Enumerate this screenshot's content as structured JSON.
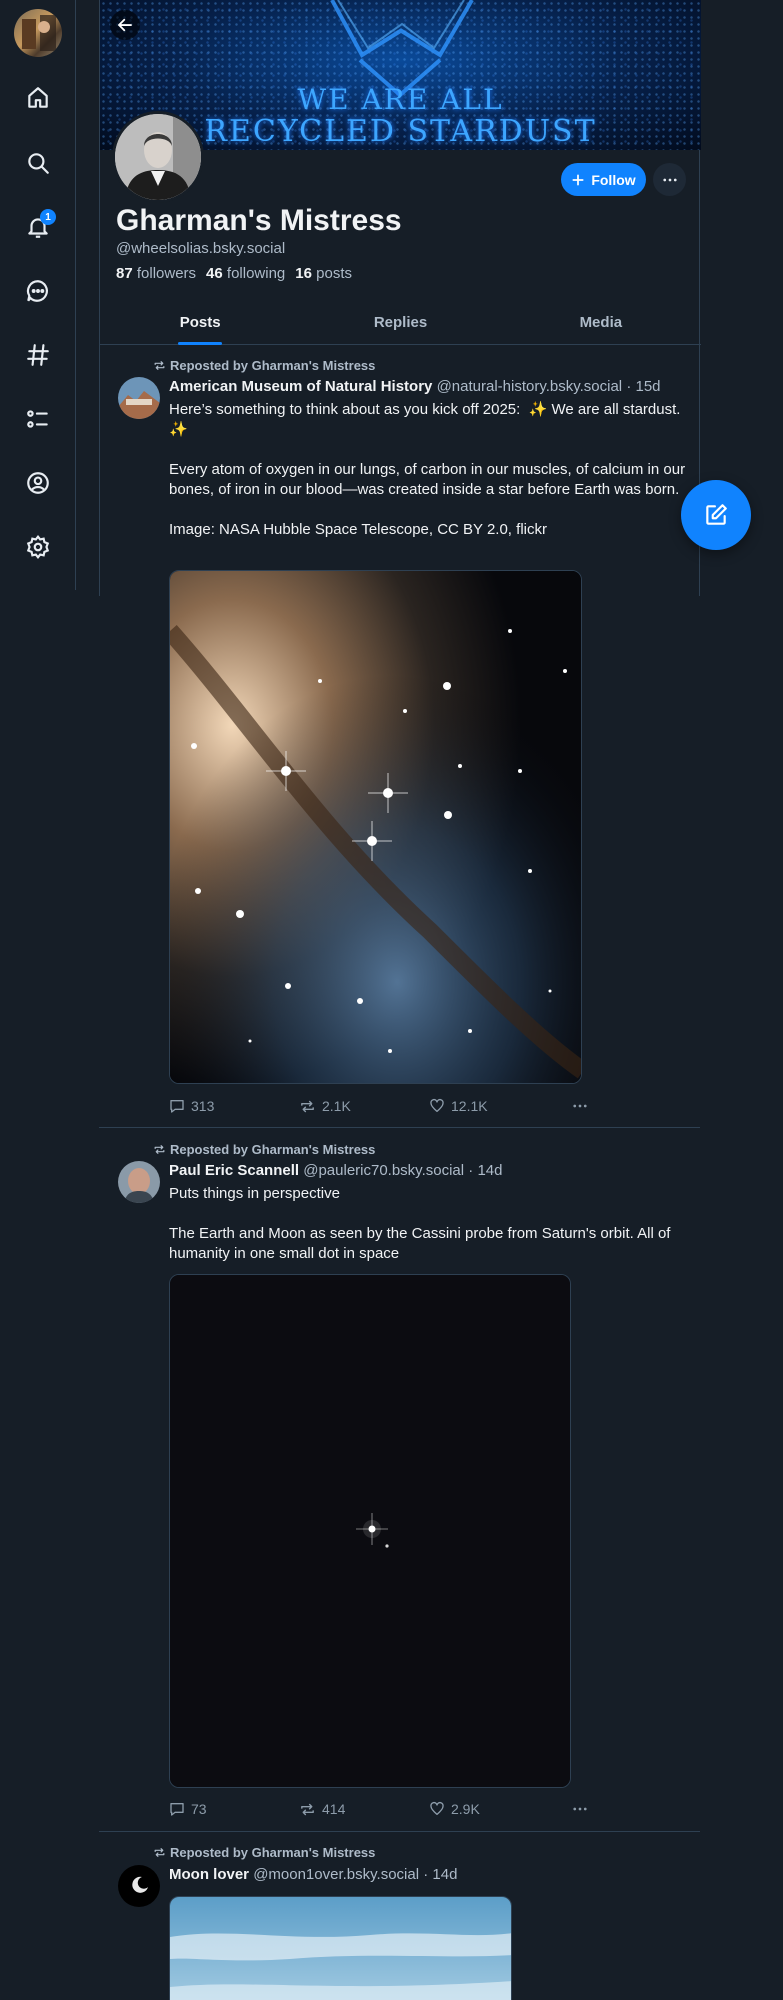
{
  "nav": {
    "notification_count": "1",
    "items": [
      "home",
      "search",
      "notifications",
      "chat",
      "feeds",
      "lists",
      "profile",
      "settings"
    ]
  },
  "profile": {
    "banner_line1": "WE ARE ALL",
    "banner_line2": "RECYCLED STARDUST",
    "display_name": "Gharman's Mistress",
    "handle": "@wheelsolias.bsky.social",
    "followers_count": "87",
    "followers_label": "followers",
    "following_count": "46",
    "following_label": "following",
    "posts_count": "16",
    "posts_label": "posts",
    "follow_label": "Follow"
  },
  "tabs": [
    {
      "label": "Posts",
      "active": true
    },
    {
      "label": "Replies",
      "active": false
    },
    {
      "label": "Media",
      "active": false
    }
  ],
  "posts": [
    {
      "repost_by": "Reposted by Gharman's Mistress",
      "author": "American Museum of Natural History",
      "handle": "@natural-history.bsky.social",
      "age": "15d",
      "text": "Here’s something to think about as you kick off 2025:  ✨ We are all stardust. ✨\n\nEvery atom of oxygen in our lungs, of carbon in our muscles, of calcium in our bones, of iron in our blood—was created inside a star before Earth was born.\n\nImage: NASA Hubble Space Telescope, CC BY 2.0, flickr",
      "replies": "313",
      "reposts": "2.1K",
      "likes": "12.1K"
    },
    {
      "repost_by": "Reposted by Gharman's Mistress",
      "author": "Paul Eric Scannell",
      "handle": "@pauleric70.bsky.social",
      "age": "14d",
      "text": "Puts things in perspective\n\nThe Earth and Moon as seen by the Cassini probe from Saturn's orbit. All of humanity in one small dot in space",
      "replies": "73",
      "reposts": "414",
      "likes": "2.9K"
    },
    {
      "repost_by": "Reposted by Gharman's Mistress",
      "author": "Moon lover",
      "handle": "@moon1over.bsky.social",
      "age": "14d"
    }
  ],
  "colors": {
    "background": "#161e27",
    "accent": "#1083fe",
    "border": "#2e4052",
    "muted_text": "#aebbc9"
  }
}
